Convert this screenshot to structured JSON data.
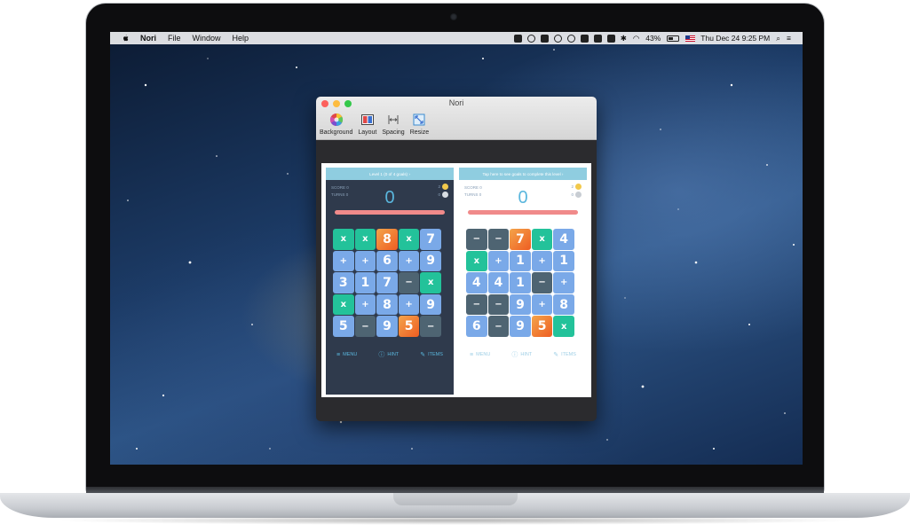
{
  "menubar": {
    "app": "Nori",
    "items": [
      "File",
      "Window",
      "Help"
    ],
    "battery": "43%",
    "clock": "Thu Dec 24  9:25 PM"
  },
  "window": {
    "title": "Nori",
    "toolbar": [
      {
        "label": "Background",
        "icon": "color-wheel-icon"
      },
      {
        "label": "Layout",
        "icon": "layout-icon"
      },
      {
        "label": "Spacing",
        "icon": "spacing-icon"
      },
      {
        "label": "Resize",
        "icon": "resize-icon"
      }
    ]
  },
  "game": {
    "dark": {
      "banner": "Level 1 (0 of 4 goals)",
      "score_label": "SCORE 0",
      "turns_label": "TURNS 0",
      "score": "0",
      "coin_gold": "2",
      "coin_silver": "0",
      "tiles": [
        {
          "v": "x",
          "c": "green"
        },
        {
          "v": "x",
          "c": "green"
        },
        {
          "v": "8",
          "c": "orange"
        },
        {
          "v": "x",
          "c": "green"
        },
        {
          "v": "7",
          "c": "blue"
        },
        {
          "v": "+",
          "c": "blue"
        },
        {
          "v": "+",
          "c": "blue"
        },
        {
          "v": "6",
          "c": "blue"
        },
        {
          "v": "+",
          "c": "blue"
        },
        {
          "v": "9",
          "c": "blue"
        },
        {
          "v": "3",
          "c": "blue"
        },
        {
          "v": "1",
          "c": "blue"
        },
        {
          "v": "7",
          "c": "blue"
        },
        {
          "v": "−",
          "c": "slate"
        },
        {
          "v": "x",
          "c": "green"
        },
        {
          "v": "x",
          "c": "green"
        },
        {
          "v": "+",
          "c": "blue"
        },
        {
          "v": "8",
          "c": "blue"
        },
        {
          "v": "+",
          "c": "blue"
        },
        {
          "v": "9",
          "c": "blue"
        },
        {
          "v": "5",
          "c": "blue"
        },
        {
          "v": "−",
          "c": "slate"
        },
        {
          "v": "9",
          "c": "blue"
        },
        {
          "v": "5",
          "c": "orange"
        },
        {
          "v": "−",
          "c": "slate"
        }
      ],
      "menu": "MENU",
      "hint": "HINT",
      "items": "ITEMS"
    },
    "light": {
      "banner": "Tap here to see goals to complete this level",
      "score_label": "SCORE 0",
      "turns_label": "TURNS 0",
      "score": "0",
      "coin_gold": "2",
      "coin_silver": "0",
      "tiles": [
        {
          "v": "−",
          "c": "slate"
        },
        {
          "v": "−",
          "c": "slate"
        },
        {
          "v": "7",
          "c": "orange"
        },
        {
          "v": "x",
          "c": "green"
        },
        {
          "v": "4",
          "c": "blue"
        },
        {
          "v": "x",
          "c": "green"
        },
        {
          "v": "+",
          "c": "blue"
        },
        {
          "v": "1",
          "c": "blue"
        },
        {
          "v": "+",
          "c": "blue"
        },
        {
          "v": "1",
          "c": "blue"
        },
        {
          "v": "4",
          "c": "blue"
        },
        {
          "v": "4",
          "c": "blue"
        },
        {
          "v": "1",
          "c": "blue"
        },
        {
          "v": "−",
          "c": "slate"
        },
        {
          "v": "+",
          "c": "blue"
        },
        {
          "v": "−",
          "c": "slate"
        },
        {
          "v": "−",
          "c": "slate"
        },
        {
          "v": "9",
          "c": "blue"
        },
        {
          "v": "+",
          "c": "blue"
        },
        {
          "v": "8",
          "c": "blue"
        },
        {
          "v": "6",
          "c": "blue"
        },
        {
          "v": "−",
          "c": "slate"
        },
        {
          "v": "9",
          "c": "blue"
        },
        {
          "v": "5",
          "c": "orange"
        },
        {
          "v": "x",
          "c": "green"
        }
      ],
      "menu": "MENU",
      "hint": "HINT",
      "items": "ITEMS"
    }
  },
  "colors": {
    "dark_panel": "#2f3a4c",
    "accent": "#5ab6dd",
    "banner": "#8fcde0",
    "bar": "#f08a8a"
  }
}
